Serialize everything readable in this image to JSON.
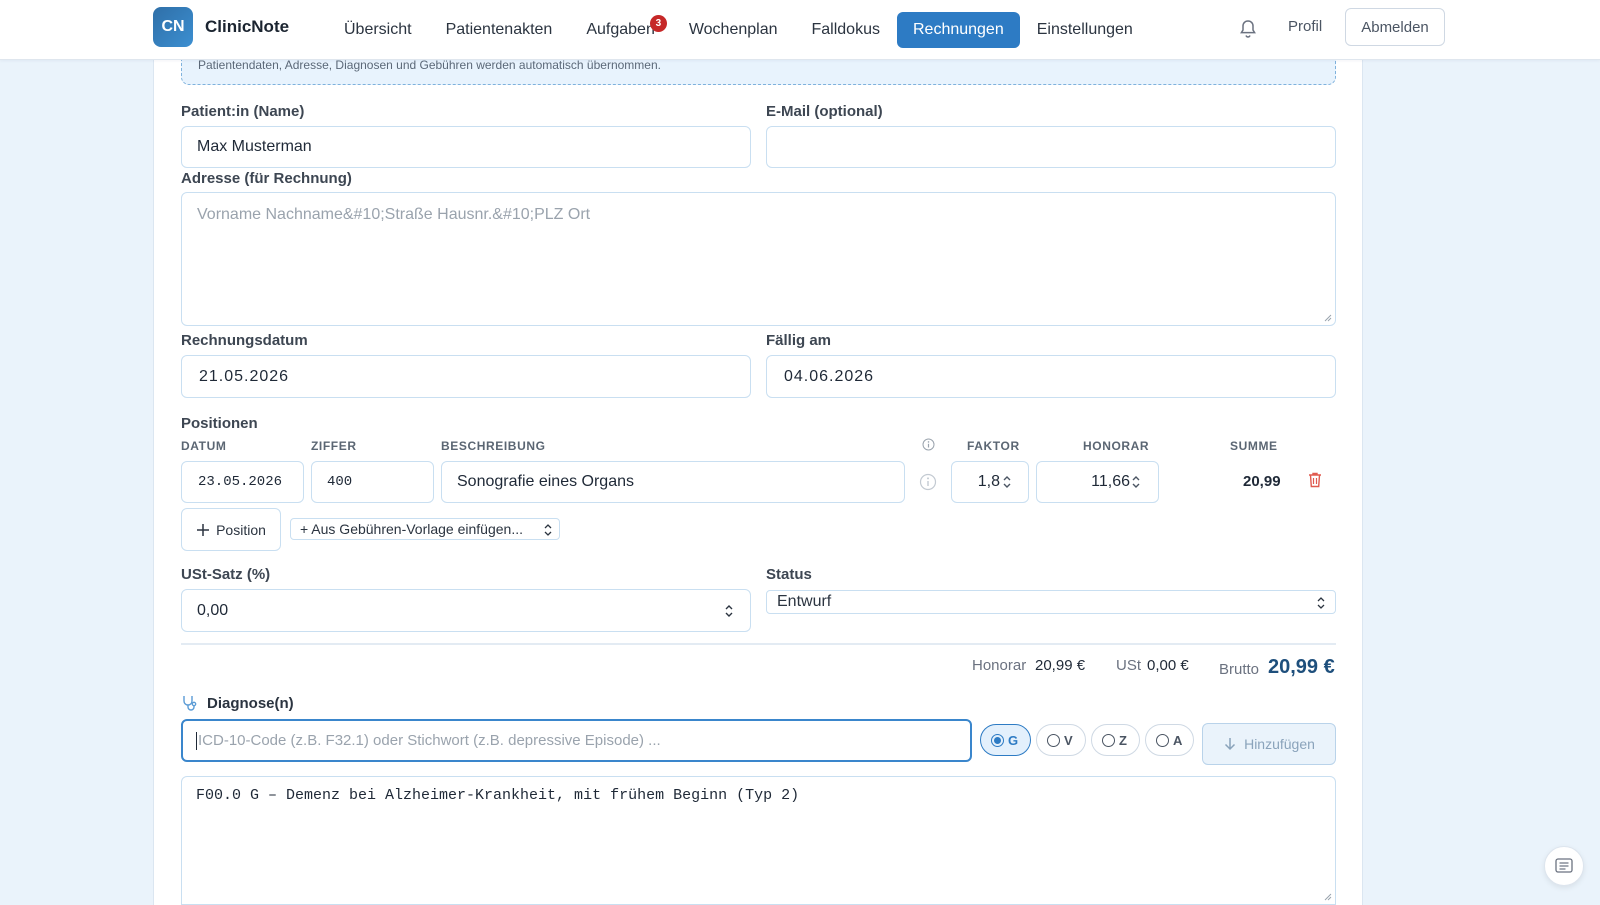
{
  "app": {
    "logo_initials": "CN",
    "name": "ClinicNote"
  },
  "nav": {
    "items": [
      {
        "label": "Übersicht"
      },
      {
        "label": "Patientenakten"
      },
      {
        "label": "Aufgaben",
        "badge": "3"
      },
      {
        "label": "Wochenplan"
      },
      {
        "label": "Falldokus"
      },
      {
        "label": "Rechnungen",
        "active": true
      },
      {
        "label": "Einstellungen"
      }
    ],
    "profile": "Profil",
    "logout": "Abmelden"
  },
  "info": {
    "text": "Patientendaten, Adresse, Diagnosen und Gebühren werden automatisch übernommen."
  },
  "patient": {
    "name_label": "Patient:in (Name)",
    "name_value": "Max Musterman",
    "email_label": "E-Mail (optional)",
    "email_value": "",
    "address_label": "Adresse (für Rechnung)",
    "address_placeholder": "Vorname Nachname&#10;Straße Hausnr.&#10;PLZ Ort"
  },
  "dates": {
    "invoice_date_label": "Rechnungsdatum",
    "invoice_date_value": "21.05.2026",
    "due_label": "Fällig am",
    "due_value": "04.06.2026"
  },
  "positions": {
    "title": "Positionen",
    "columns": {
      "date": "DATUM",
      "code": "ZIFFER",
      "description": "BESCHREIBUNG",
      "factor": "FAKTOR",
      "fee": "HONORAR",
      "sum": "SUMME"
    },
    "rows": [
      {
        "date": "23.05.2026",
        "code": "400",
        "description": "Sonografie eines Organs",
        "factor": "1,8",
        "fee": "11,66",
        "sum": "20,99"
      }
    ],
    "add_label": "Position",
    "template_select": "+ Aus Gebühren-Vorlage einfügen..."
  },
  "tax": {
    "label": "USt-Satz (%)",
    "value": "0,00"
  },
  "status": {
    "label": "Status",
    "value": "Entwurf"
  },
  "totals": {
    "honorar_label": "Honorar",
    "honorar_value": "20,99 €",
    "ust_label": "USt",
    "ust_value": "0,00 €",
    "brutto_label": "Brutto",
    "brutto_value": "20,99 €"
  },
  "diagnoses": {
    "title": "Diagnose(n)",
    "search_placeholder": "ICD-10-Code (z.B. F32.1) oder Stichwort (z.B. depressive Episode) ...",
    "certainty_options": [
      {
        "label": "G",
        "selected": true
      },
      {
        "label": "V",
        "selected": false
      },
      {
        "label": "Z",
        "selected": false
      },
      {
        "label": "A",
        "selected": false
      }
    ],
    "add_label": "Hinzufügen",
    "list_text": "F00.0 G – Demenz bei Alzheimer-Krankheit, mit frühem Beginn (Typ 2)"
  },
  "colors": {
    "accent": "#2d7bc4",
    "brand_gradient_start": "#2f6fa8",
    "brand_gradient_end": "#3c8fd1",
    "badge": "#c62828",
    "delete": "#e05a4f",
    "brutto": "#1e4f7c"
  },
  "icons": {
    "bell": "bell-icon",
    "plus": "plus-icon",
    "trash": "trash-icon",
    "info": "info-icon",
    "stethoscope": "stethoscope-icon",
    "arrow_down": "arrow-down-icon",
    "chat": "chat-icon"
  }
}
